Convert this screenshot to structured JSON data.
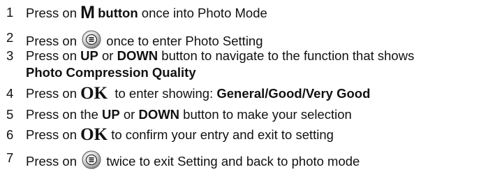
{
  "steps": [
    {
      "num": "1",
      "a": "Press on ",
      "b": "M",
      "c": " button",
      "d": " once into Photo Mode"
    },
    {
      "num": "2",
      "a": "Press on ",
      "icon": "menu-button-icon",
      "b": " once to enter Photo Setting"
    },
    {
      "num": "3",
      "a": "Press on ",
      "b": "UP",
      "c": " or ",
      "d": "DOWN",
      "e": " button to navigate to the function that shows",
      "f": "Photo Compression Quality"
    },
    {
      "num": "4",
      "a": "Press on ",
      "b": "OK",
      "c": "  to enter showing: ",
      "d": "General/Good/Very Good"
    },
    {
      "num": "5",
      "a": "Press on the ",
      "b": "UP",
      "c": " or ",
      "d": "DOWN",
      "e": " button to make your selection"
    },
    {
      "num": "6",
      "a": "Press on ",
      "b": "OK",
      "c": " to confirm your entry and exit to setting"
    },
    {
      "num": "7",
      "a": "Press on ",
      "icon": "menu-button-icon",
      "b": " twice to exit Setting and back to photo mode"
    }
  ]
}
